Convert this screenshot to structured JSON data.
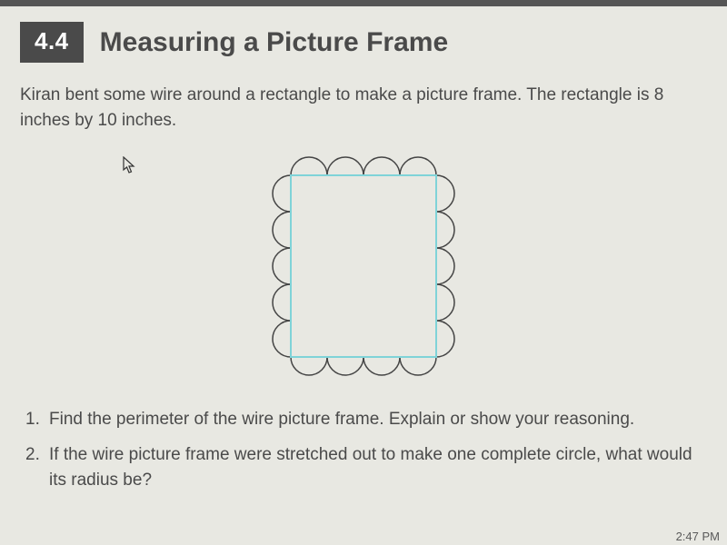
{
  "section": {
    "number": "4.4",
    "title": "Measuring a Picture Frame"
  },
  "intro": "Kiran bent some wire around a rectangle to make a picture frame. The rectangle is 8 inches by 10 inches.",
  "questions": [
    "Find the perimeter of the wire picture frame. Explain or show your reasoning.",
    "If the wire picture frame were stretched out to make one complete circle, what would its radius be?"
  ],
  "figure": {
    "rect_stroke": "#7fd3d8",
    "scallop_stroke": "#444444",
    "background": "#e8e8e2"
  },
  "status": {
    "time": "2:47 PM"
  }
}
